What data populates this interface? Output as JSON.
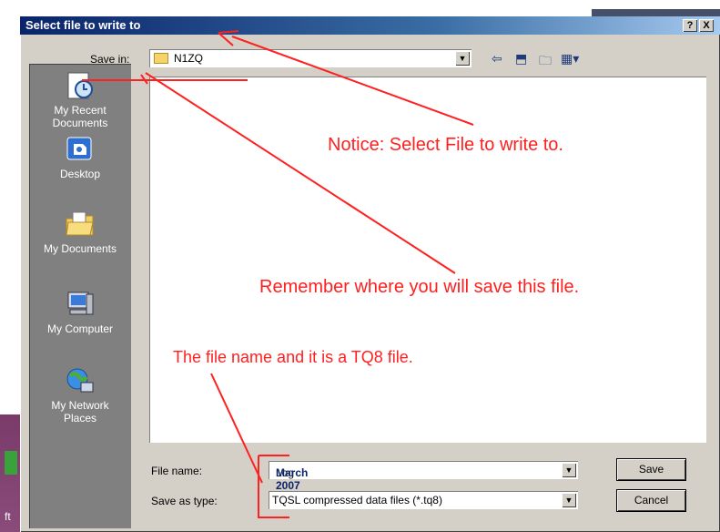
{
  "dialog": {
    "title": "Select file to write to",
    "help_label": "?",
    "close_label": "X"
  },
  "toolbar": {
    "save_in_label": "Save in:",
    "save_in_value": "N1ZQ",
    "icons": [
      "back-arrow-icon",
      "up-folder-icon",
      "new-folder-icon",
      "view-menu-icon"
    ]
  },
  "places": [
    {
      "label1": "My Recent",
      "label2": "Documents",
      "icon": "recent-documents-icon"
    },
    {
      "label1": "Desktop",
      "label2": "",
      "icon": "desktop-icon"
    },
    {
      "label1": "My Documents",
      "label2": "",
      "icon": "my-documents-icon"
    },
    {
      "label1": "My Computer",
      "label2": "",
      "icon": "my-computer-icon"
    },
    {
      "label1": "My Network",
      "label2": "Places",
      "icon": "network-places-icon"
    }
  ],
  "form": {
    "file_name_label": "File name:",
    "file_name_value_prefix": "Log ",
    "file_name_value_highlight": "March 2007",
    "save_as_type_label": "Save as type:",
    "save_as_type_value": "TQSL compressed data files (*.tq8)",
    "save_button": "Save",
    "cancel_button": "Cancel"
  },
  "annotations": {
    "notice": "Notice: Select File to write to.",
    "remember": "Remember where you will save this file.",
    "filename_note": "The file name and it is a TQ8 file.",
    "color": "#ff2020"
  },
  "background": {
    "taskbar_fragment": "ft"
  }
}
